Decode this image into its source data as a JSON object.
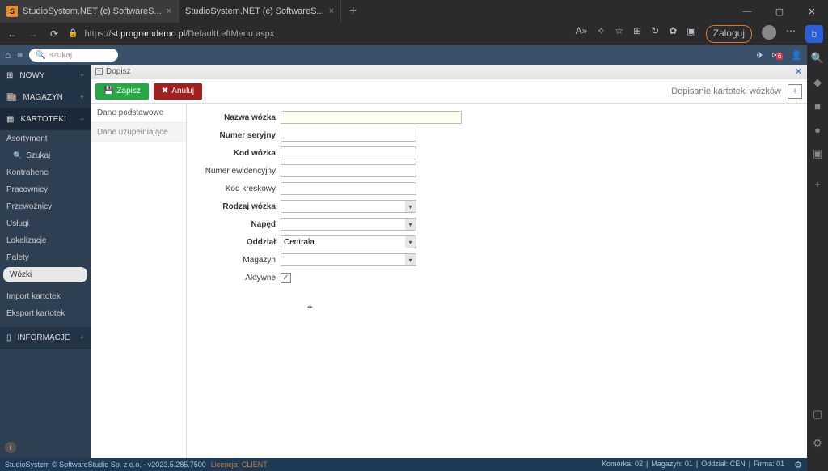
{
  "browser": {
    "tabs": [
      {
        "title": "StudioSystem.NET (c) SoftwareS...",
        "active": true
      },
      {
        "title": "StudioSystem.NET (c) SoftwareS...",
        "active": false
      }
    ],
    "url_prefix": "https://",
    "url_host": "st.programdemo.pl",
    "url_path": "/DefaultLeftMenu.aspx",
    "login_btn": "Zaloguj"
  },
  "app": {
    "search_placeholder": "szukaj",
    "notif_count": "6"
  },
  "sidebar": {
    "groups": [
      "NOWY",
      "MAGAZYN",
      "KARTOTEKI",
      "INFORMACJE"
    ],
    "kartoteki_items": [
      {
        "label": "Asortyment",
        "indent": false
      },
      {
        "label": "Szukaj",
        "indent": true,
        "icon": "search"
      },
      {
        "label": "Kontrahenci",
        "indent": false
      },
      {
        "label": "Pracownicy",
        "indent": false
      },
      {
        "label": "Przewoźnicy",
        "indent": false
      },
      {
        "label": "Usługi",
        "indent": false
      },
      {
        "label": "Lokalizacje",
        "indent": false
      },
      {
        "label": "Palety",
        "indent": false
      },
      {
        "label": "Wózki",
        "indent": false,
        "active": true
      },
      {
        "label": "Import kartotek",
        "indent": false
      },
      {
        "label": "Eksport kartotek",
        "indent": false
      }
    ]
  },
  "crumb": {
    "title": "Dopisz"
  },
  "toolbar": {
    "save": "Zapisz",
    "cancel": "Anuluj",
    "heading": "Dopisanie kartoteki wózków"
  },
  "subtabs": [
    "Dane podstawowe",
    "Dane uzupełniające"
  ],
  "form": {
    "fields": [
      {
        "label": "Nazwa wózka",
        "bold": true,
        "type": "text",
        "cls": "w-long",
        "value": ""
      },
      {
        "label": "Numer seryjny",
        "bold": true,
        "type": "text",
        "cls": "w-mid",
        "value": ""
      },
      {
        "label": "Kod wózka",
        "bold": true,
        "type": "text",
        "cls": "w-mid",
        "value": ""
      },
      {
        "label": "Numer ewidencyjny",
        "bold": false,
        "type": "text",
        "cls": "w-mid",
        "value": ""
      },
      {
        "label": "Kod kreskowy",
        "bold": false,
        "type": "text",
        "cls": "w-mid",
        "value": ""
      },
      {
        "label": "Rodzaj wózka",
        "bold": true,
        "type": "select",
        "value": ""
      },
      {
        "label": "Napęd",
        "bold": true,
        "type": "select",
        "value": ""
      },
      {
        "label": "Oddział",
        "bold": true,
        "type": "select",
        "value": "Centrala"
      },
      {
        "label": "Magazyn",
        "bold": false,
        "type": "select",
        "value": ""
      },
      {
        "label": "Aktywne",
        "bold": false,
        "type": "check",
        "value": true
      }
    ]
  },
  "status": {
    "left": "StudioSystem © SoftwareStudio Sp. z o.o. - v2023.5.285.7500",
    "lic": "Licencja: CLIENT",
    "cells": [
      "Komórka: 02",
      "Magazyn: 01",
      "Oddział: CEN",
      "Firma: 01"
    ]
  }
}
